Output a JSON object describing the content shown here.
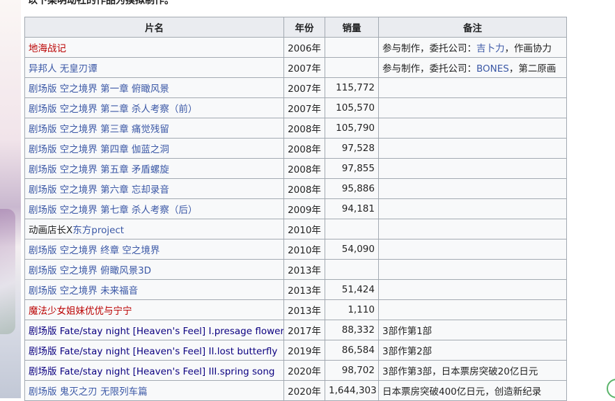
{
  "intro_text": "以下染明动社的作品为摸拟制作。",
  "table": {
    "headers": [
      "片名",
      "年份",
      "销量",
      "备注"
    ],
    "rows": [
      {
        "title": "地海战记",
        "title_color": "red",
        "year": "2006年",
        "sales": "",
        "note_prefix": "参与制作，委托公司：",
        "note_link": "吉卜力",
        "note_suffix": "，作画协力"
      },
      {
        "title": "异邦人 无皇刃谭",
        "title_color": "link",
        "year": "2007年",
        "sales": "",
        "note_prefix": "参与制作，委托公司：",
        "note_link": "BONES",
        "note_suffix": "，第二原画"
      },
      {
        "title": "剧场版 空之境界 第一章 俯瞰风景",
        "title_color": "link",
        "year": "2007年",
        "sales": "115,772",
        "note_prefix": "",
        "note_link": "",
        "note_suffix": ""
      },
      {
        "title": "剧场版 空之境界 第二章 杀人考察（前）",
        "title_color": "link",
        "year": "2007年",
        "sales": "105,570",
        "note_prefix": "",
        "note_link": "",
        "note_suffix": ""
      },
      {
        "title": "剧场版 空之境界 第三章 痛觉残留",
        "title_color": "link",
        "year": "2008年",
        "sales": "105,790",
        "note_prefix": "",
        "note_link": "",
        "note_suffix": ""
      },
      {
        "title": "剧场版 空之境界 第四章 伽蓝之洞",
        "title_color": "link",
        "year": "2008年",
        "sales": "97,528",
        "note_prefix": "",
        "note_link": "",
        "note_suffix": ""
      },
      {
        "title": "剧场版 空之境界 第五章 矛盾螺旋",
        "title_color": "link",
        "year": "2008年",
        "sales": "97,855",
        "note_prefix": "",
        "note_link": "",
        "note_suffix": ""
      },
      {
        "title": "剧场版 空之境界 第六章 忘却录音",
        "title_color": "link",
        "year": "2008年",
        "sales": "95,886",
        "note_prefix": "",
        "note_link": "",
        "note_suffix": ""
      },
      {
        "title": "剧场版 空之境界 第七章 杀人考察（后）",
        "title_color": "link",
        "year": "2009年",
        "sales": "94,181",
        "note_prefix": "",
        "note_link": "",
        "note_suffix": ""
      },
      {
        "title_prefix": "动画店长X",
        "title": "东方project",
        "title_color": "mixed",
        "year": "2010年",
        "sales": "",
        "note_prefix": "",
        "note_link": "",
        "note_suffix": ""
      },
      {
        "title": "剧场版 空之境界 终章 空之境界",
        "title_color": "link",
        "year": "2010年",
        "sales": "54,090",
        "note_prefix": "",
        "note_link": "",
        "note_suffix": ""
      },
      {
        "title": "剧场版 空之境界 俯瞰风景3D",
        "title_color": "link",
        "year": "2013年",
        "sales": "",
        "note_prefix": "",
        "note_link": "",
        "note_suffix": ""
      },
      {
        "title": "剧场版 空之境界 未来福音",
        "title_color": "link",
        "year": "2013年",
        "sales": "51,424",
        "note_prefix": "",
        "note_link": "",
        "note_suffix": ""
      },
      {
        "title": "魔法少女姐妹优优与宁宁",
        "title_color": "red",
        "year": "2013年",
        "sales": "1,110",
        "note_prefix": "",
        "note_link": "",
        "note_suffix": ""
      },
      {
        "title": "剧场版 Fate/stay night [Heaven's Feel] I.presage flower",
        "title_color": "dark",
        "year": "2017年",
        "sales": "88,332",
        "note_prefix": "3部作第1部",
        "note_link": "",
        "note_suffix": ""
      },
      {
        "title": "剧场版 Fate/stay night [Heaven's Feel] II.lost butterfly",
        "title_color": "dark",
        "year": "2019年",
        "sales": "86,584",
        "note_prefix": "3部作第2部",
        "note_link": "",
        "note_suffix": ""
      },
      {
        "title": "剧场版 Fate/stay night [Heaven's Feel] III.spring song",
        "title_color": "dark",
        "year": "2020年",
        "sales": "98,702",
        "note_prefix": "3部作第3部，日本票房突破20亿日元",
        "note_link": "",
        "note_suffix": ""
      },
      {
        "title": "剧场版 鬼灭之刃 无限列车篇",
        "title_color": "link",
        "year": "2020年",
        "sales": "1,644,303",
        "note_prefix": "日本票房突破400亿日元，创造新纪录",
        "note_link": "",
        "note_suffix": ""
      }
    ]
  },
  "colors": {
    "link": "#3b58a6",
    "red": "#ba0000",
    "dark": "#0b0080",
    "header_bg": "#eaecf0",
    "border": "#a2a9b1"
  }
}
